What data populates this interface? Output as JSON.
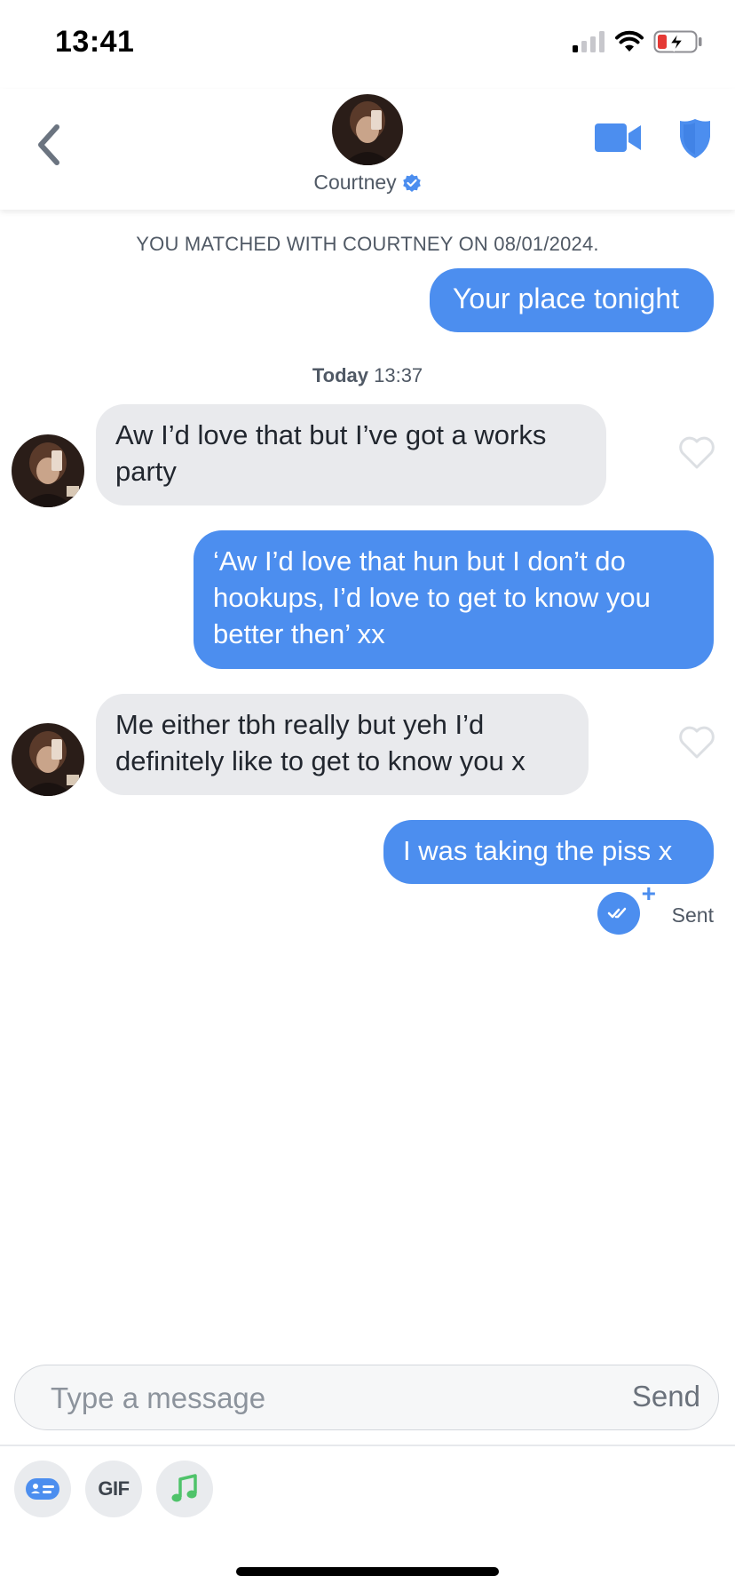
{
  "status_bar": {
    "time": "13:41",
    "icons": [
      "signal-icon",
      "wifi-icon",
      "battery-icon"
    ]
  },
  "header": {
    "name": "Courtney",
    "icons": [
      "back-chevron-icon",
      "verified-badge-icon",
      "video-camera-icon",
      "shield-icon"
    ]
  },
  "chat": {
    "matched_notice": "YOU MATCHED WITH COURTNEY ON 08/01/2024.",
    "timestamp_day": "Today",
    "timestamp_time": "13:37",
    "messages": [
      {
        "direction": "out",
        "text": "Your place tonight"
      },
      {
        "direction": "in",
        "text": "Aw I’d love that but I’ve got a works party"
      },
      {
        "direction": "out",
        "text": "‘Aw I’d love that hun but I don’t do hookups, I’d love to get to know you better then’ xx"
      },
      {
        "direction": "in",
        "text": "Me either tbh really but yeh I’d definitely like to get to know you x"
      },
      {
        "direction": "out",
        "text": "I was taking the piss x"
      }
    ],
    "sent_status": "Sent"
  },
  "composer": {
    "placeholder": "Type a message",
    "send_label": "Send"
  },
  "toolbar": {
    "gif_label": "GIF",
    "icons": [
      "sticker-card-icon",
      "gif-icon",
      "music-note-icon"
    ]
  },
  "colors": {
    "accent": "#4c8eef",
    "incoming_bubble": "#e9eaed",
    "text_secondary": "#505965"
  }
}
